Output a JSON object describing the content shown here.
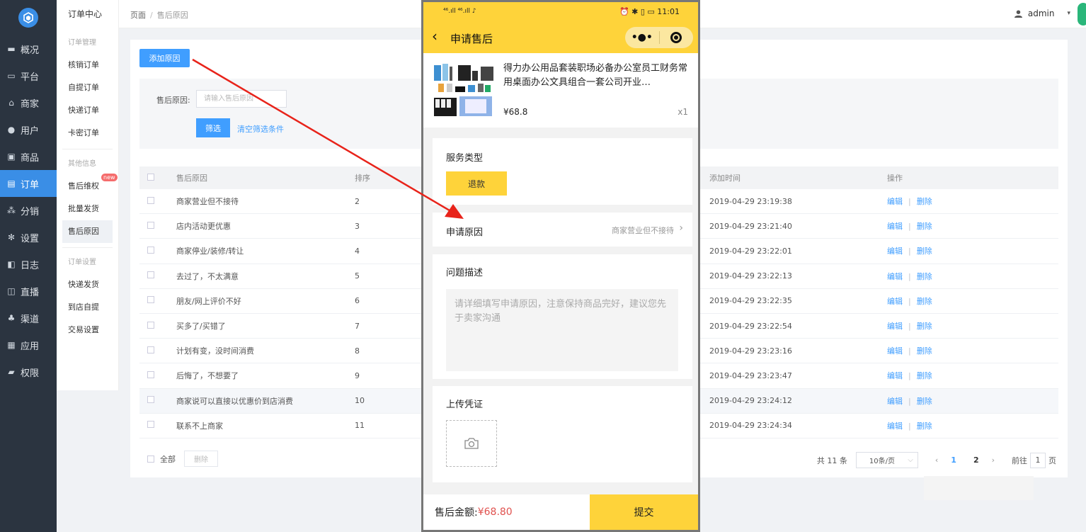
{
  "sidebar": {
    "items": [
      {
        "label": "概况",
        "icon": "monitor-icon"
      },
      {
        "label": "平台",
        "icon": "desktop-icon"
      },
      {
        "label": "商家",
        "icon": "store-icon"
      },
      {
        "label": "用户",
        "icon": "user-icon"
      },
      {
        "label": "商品",
        "icon": "goods-icon"
      },
      {
        "label": "订单",
        "icon": "order-icon",
        "active": true
      },
      {
        "label": "分销",
        "icon": "distribution-icon"
      },
      {
        "label": "设置",
        "icon": "gear-icon"
      },
      {
        "label": "日志",
        "icon": "log-icon"
      },
      {
        "label": "直播",
        "icon": "live-icon"
      },
      {
        "label": "渠道",
        "icon": "channel-icon"
      },
      {
        "label": "应用",
        "icon": "apps-icon"
      },
      {
        "label": "权限",
        "icon": "lock-icon"
      }
    ]
  },
  "submenu": {
    "title": "订单中心",
    "group1": "订单管理",
    "group1_items": [
      "核销订单",
      "自提订单",
      "快递订单",
      "卡密订单"
    ],
    "group2": "其他信息",
    "group2_items": [
      "售后维权",
      "批量发货",
      "售后原因"
    ],
    "new_badge": "new",
    "group3": "订单设置",
    "group3_items": [
      "快递发货",
      "到店自提",
      "交易设置"
    ]
  },
  "topbar": {
    "breadcrumb_root": "页面",
    "breadcrumb_sep": "/",
    "breadcrumb_current": "售后原因",
    "username": "admin",
    "caret": "▾"
  },
  "content": {
    "add_button": "添加原因",
    "filter_label": "售后原因:",
    "filter_placeholder": "请输入售后原因",
    "filter_button": "筛选",
    "clear_link": "清空筛选条件",
    "columns": [
      "售后原因",
      "排序",
      "添加时间",
      "操作"
    ],
    "rows": [
      {
        "reason": "商家营业但不接待",
        "sort": "2",
        "time": "2019-04-29 23:19:38"
      },
      {
        "reason": "店内活动更优惠",
        "sort": "3",
        "time": "2019-04-29 23:21:40"
      },
      {
        "reason": "商家停业/装修/转让",
        "sort": "4",
        "time": "2019-04-29 23:22:01"
      },
      {
        "reason": "去过了，不太满意",
        "sort": "5",
        "time": "2019-04-29 23:22:13"
      },
      {
        "reason": "朋友/网上评价不好",
        "sort": "6",
        "time": "2019-04-29 23:22:35"
      },
      {
        "reason": "买多了/买错了",
        "sort": "7",
        "time": "2019-04-29 23:22:54"
      },
      {
        "reason": "计划有变，没时间消费",
        "sort": "8",
        "time": "2019-04-29 23:23:16"
      },
      {
        "reason": "后悔了，不想要了",
        "sort": "9",
        "time": "2019-04-29 23:23:47"
      },
      {
        "reason": "商家说可以直接以优惠价到店消费",
        "sort": "10",
        "time": "2019-04-29 23:24:12",
        "highlight": true
      },
      {
        "reason": "联系不上商家",
        "sort": "11",
        "time": "2019-04-29 23:24:34"
      }
    ],
    "op_edit": "编辑",
    "op_sep": "|",
    "op_delete": "删除",
    "select_all": "全部",
    "bulk_delete": "删除",
    "total": "共 11 条",
    "page_size": "10条/页",
    "page_size_caret": "⌵",
    "prev": "‹",
    "page1": "1",
    "page2": "2",
    "next": "›",
    "goto_prefix": "前往",
    "goto_value": "1",
    "goto_suffix": "页"
  },
  "phone": {
    "status_left": "⁴⁶.ıll ⁴⁶.ıll ♪",
    "status_right": "⏰ ✱ ▯ ▭ 11:01",
    "title": "申请售后",
    "back": "‹",
    "capsule_dots": "•●•",
    "product_name": "得力办公用品套装职场必备办公室员工财务常用桌面办公文具组合一套公司开业…",
    "product_price": "¥68.8",
    "product_qty": "x1",
    "service_type_label": "服务类型",
    "refund_button": "退款",
    "reason_label": "申请原因",
    "reason_value": "商家营业但不接待",
    "reason_arrow": "›",
    "desc_label": "问题描述",
    "desc_placeholder": "请详细填写申请原因，注意保持商品完好，建议您先于卖家沟通",
    "upload_label": "上传凭证",
    "amount_label": "售后金额:",
    "amount_value": "¥68.80",
    "submit": "提交"
  },
  "colors": {
    "sidebar_bg": "#2b3440",
    "accent": "#409eff",
    "phone_yellow": "#fed33a",
    "arrow_red": "#e8231a",
    "price_red": "#e0524f"
  }
}
